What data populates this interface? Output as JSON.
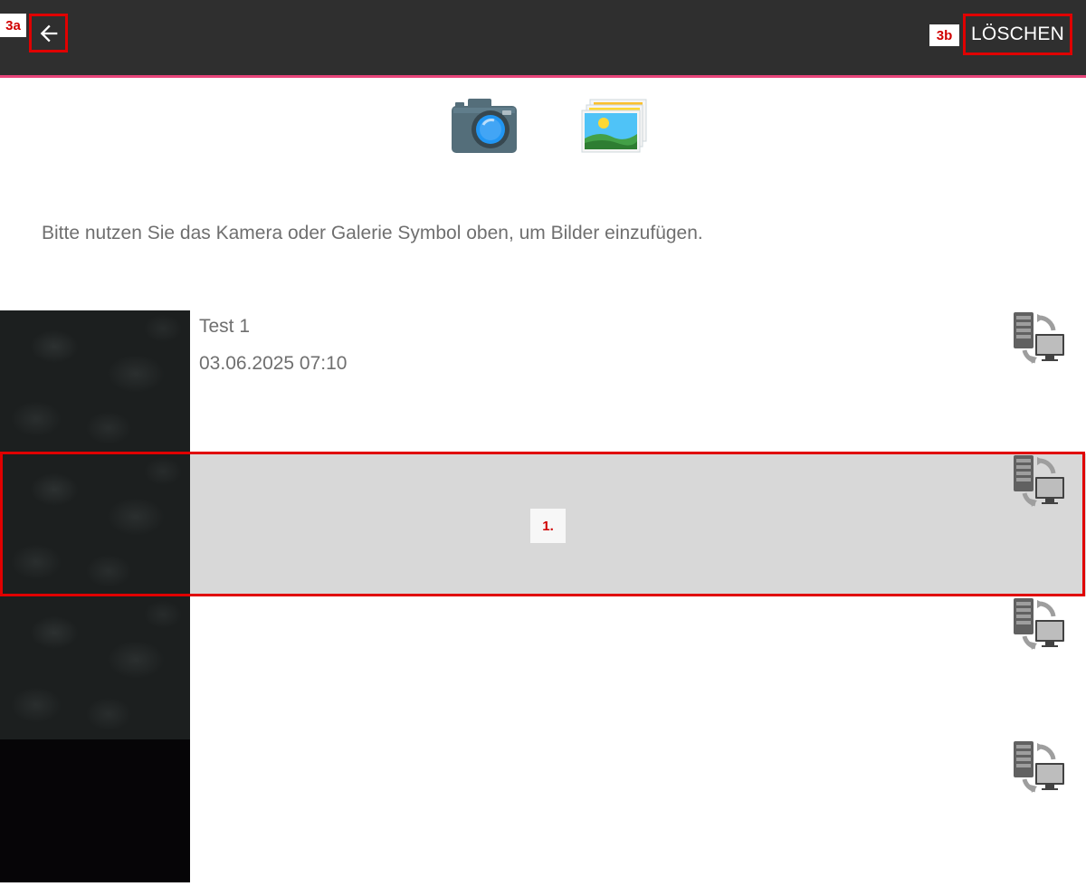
{
  "topbar": {
    "back_icon": "arrow-left-icon",
    "delete_label": "LÖSCHEN",
    "accent_color": "#e8457a",
    "bg_color": "#2f2f2f"
  },
  "annotations": {
    "back": "3a",
    "delete": "3b",
    "row": "1."
  },
  "media": {
    "camera_icon": "camera-icon",
    "gallery_icon": "gallery-icon"
  },
  "hint_text": "Bitte nutzen Sie das Kamera oder Galerie Symbol oben, um Bilder einzufügen.",
  "images": [
    {
      "title": "Test 1",
      "date": "03.06.2025 07:10",
      "sync_icon": "sync-server-icon"
    },
    {
      "title": "",
      "date": "",
      "sync_icon": "sync-server-icon",
      "selected": true
    },
    {
      "title": "",
      "date": "",
      "sync_icon": "sync-server-icon"
    },
    {
      "title": "",
      "date": "",
      "sync_icon": "sync-server-icon"
    }
  ],
  "highlight_color": "#e00000"
}
